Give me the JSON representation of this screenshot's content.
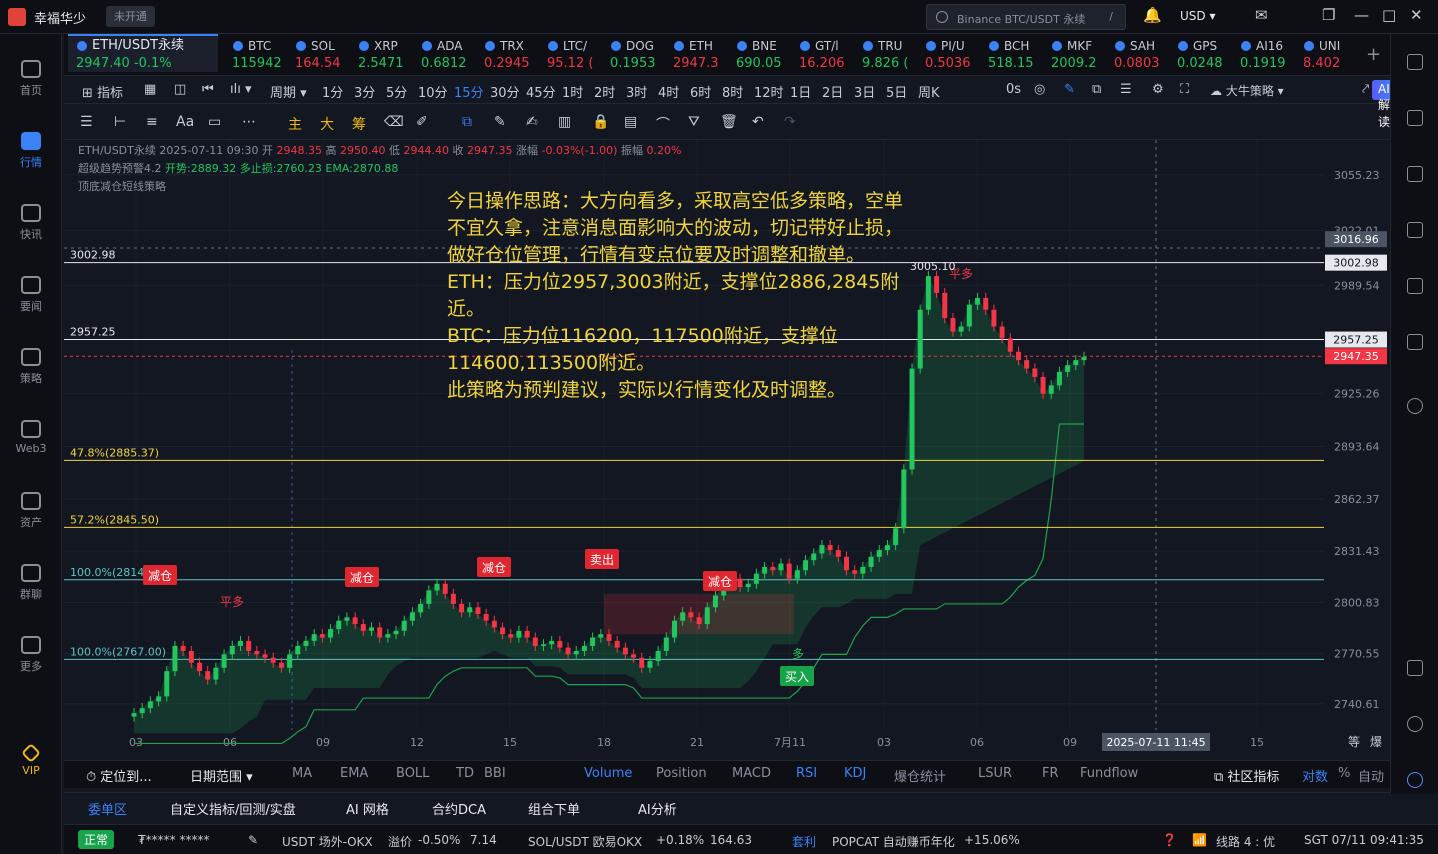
{
  "app": {
    "title": "幸福华少",
    "badge": "未开通",
    "search_placeholder": "Binance BTC/USDT 永续",
    "search_shortcut": "/",
    "currency": "USD"
  },
  "sidebar": [
    {
      "label": "首页",
      "icon": "home-icon"
    },
    {
      "label": "行情",
      "icon": "chart-bars-icon",
      "active": true
    },
    {
      "label": "快讯",
      "icon": "news-icon"
    },
    {
      "label": "要闻",
      "icon": "article-icon"
    },
    {
      "label": "策略",
      "icon": "robot-icon"
    },
    {
      "label": "Web3",
      "icon": "web3-icon"
    },
    {
      "label": "资产",
      "icon": "wallet-icon"
    },
    {
      "label": "群聊",
      "icon": "chat-icon"
    },
    {
      "label": "更多",
      "icon": "grid-icon"
    },
    {
      "label": "VIP",
      "icon": "vip-diamond-icon"
    }
  ],
  "tickers": {
    "main": {
      "name": "ETH/USDT永续",
      "price": "2947.40",
      "change": "-0.1%"
    },
    "list": [
      {
        "name": "BTC",
        "price": "115942",
        "dir": "up"
      },
      {
        "name": "SOL",
        "price": "164.54",
        "dir": "dn"
      },
      {
        "name": "XRP",
        "price": "2.5471",
        "dir": "up"
      },
      {
        "name": "ADA",
        "price": "0.6812",
        "dir": "up"
      },
      {
        "name": "TRX",
        "price": "0.2945",
        "dir": "dn"
      },
      {
        "name": "LTC/",
        "price": "95.12 (",
        "dir": "dn"
      },
      {
        "name": "DOG",
        "price": "0.1953",
        "dir": "up"
      },
      {
        "name": "ETH",
        "price": "2947.3",
        "dir": "dn"
      },
      {
        "name": "BNE",
        "price": "690.05",
        "dir": "up"
      },
      {
        "name": "GT/l",
        "price": "16.206",
        "dir": "dn"
      },
      {
        "name": "TRU",
        "price": "9.826 (",
        "dir": "up"
      },
      {
        "name": "PI/U",
        "price": "0.5036",
        "dir": "dn"
      },
      {
        "name": "BCH",
        "price": "518.15",
        "dir": "up"
      },
      {
        "name": "MKF",
        "price": "2009.2",
        "dir": "up"
      },
      {
        "name": "SAH",
        "price": "0.0803",
        "dir": "dn"
      },
      {
        "name": "GPS",
        "price": "0.0248",
        "dir": "up"
      },
      {
        "name": "AI16",
        "price": "0.1919",
        "dir": "up"
      },
      {
        "name": "UNI",
        "price": "8.402",
        "dir": "dn"
      }
    ]
  },
  "toolbar1": {
    "indicator": "指标",
    "cycle": "周期",
    "intervals": [
      "1分",
      "3分",
      "5分",
      "10分",
      "15分",
      "30分",
      "45分",
      "1时",
      "2时",
      "3时",
      "4时",
      "6时",
      "8时",
      "12时",
      "1日",
      "2日",
      "3日",
      "5日",
      "周K"
    ],
    "selected_interval": "15分",
    "timer": "0s",
    "bull_strategy": "大牛策略",
    "ai_label": "AI解读"
  },
  "toolbar2": {
    "zhu": "主",
    "da": "大",
    "chou": "筹",
    "font": "Aa"
  },
  "legend": {
    "symbol": "ETH/USDT永续",
    "datetime": "2025-07-11 09:30",
    "open_label": "开",
    "open": "2948.35",
    "high_label": "高",
    "high": "2950.40",
    "low_label": "低",
    "low": "2944.40",
    "close_label": "收",
    "close": "2947.35",
    "amp_label": "涨幅",
    "amp": "-0.03%(-1.00)",
    "swing_label": "振幅",
    "swing": "0.20%",
    "ind1": "超级趋势预警4.2",
    "ind1_a": "开势:2889.32",
    "ind1_b": "多止损:2760.23",
    "ind1_c": "EMA:2870.88",
    "ind2": "顶底减仓短线策略"
  },
  "note": [
    "今日操作思路：大方向看多，采取高空低多策略，空单不宜久拿，注意消息面影响大的波动，切记带好止损，做好仓位管理，行情有变点位要及时调整和撤单。",
    "ETH：压力位2957,3003附近，支撑位2886,2845附近。",
    "BTC：压力位116200，117500附近，支撑位114600,113500附近。",
    "此策略为预判建议，实际以行情变化及时调整。"
  ],
  "chart_data": {
    "type": "candlestick",
    "y_ticks": [
      "3055.23",
      "3022.01",
      "2989.54",
      "2957.25",
      "2925.26",
      "2893.64",
      "2862.37",
      "2831.43",
      "2800.83",
      "2770.55",
      "2740.61"
    ],
    "x_ticks": [
      "03",
      "06",
      "09",
      "12",
      "15",
      "18",
      "21",
      "7月11",
      "03",
      "06",
      "09",
      "15"
    ],
    "crosshair_time": "2025-07-11 11:45",
    "price_labels": {
      "crosshair": "3016.96",
      "hl_3002": "3002.98",
      "hl_2957": "2957.25",
      "last": "2947.35"
    },
    "horizontal_lines": [
      {
        "label": "3002.98",
        "value": 3002.98
      },
      {
        "label": "2957.25",
        "value": 2957.25
      },
      {
        "label": "47.8%(2885.37)",
        "value": 2885.37
      },
      {
        "label": "57.2%(2845.50)",
        "value": 2845.5
      },
      {
        "label": "100.0%(2814.35)",
        "value": 2814.35
      },
      {
        "label": "100.0%(2767.00)",
        "value": 2767.0
      }
    ],
    "peak_label": "3005.10",
    "markers": [
      {
        "text": "减仓",
        "type": "reduce"
      },
      {
        "text": "平多",
        "type": "close"
      },
      {
        "text": "减仓",
        "type": "reduce"
      },
      {
        "text": "减仓",
        "type": "reduce"
      },
      {
        "text": "卖出",
        "type": "sell"
      },
      {
        "text": "减仓",
        "type": "reduce"
      },
      {
        "text": "买入",
        "type": "buy"
      },
      {
        "text": "多",
        "type": "long"
      },
      {
        "text": "平多",
        "type": "close"
      }
    ],
    "ohlc_path": [
      2735,
      2738,
      2742,
      2745,
      2760,
      2775,
      2772,
      2765,
      2760,
      2755,
      2762,
      2770,
      2775,
      2778,
      2772,
      2770,
      2768,
      2765,
      2762,
      2770,
      2775,
      2778,
      2782,
      2780,
      2785,
      2790,
      2792,
      2788,
      2784,
      2786,
      2780,
      2782,
      2784,
      2790,
      2795,
      2800,
      2808,
      2812,
      2806,
      2800,
      2795,
      2798,
      2794,
      2790,
      2786,
      2782,
      2780,
      2784,
      2780,
      2775,
      2776,
      2778,
      2774,
      2770,
      2772,
      2775,
      2780,
      2782,
      2778,
      2774,
      2770,
      2768,
      2762,
      2766,
      2772,
      2780,
      2790,
      2795,
      2792,
      2788,
      2798,
      2805,
      2812,
      2815,
      2810,
      2812,
      2818,
      2822,
      2820,
      2824,
      2815,
      2820,
      2826,
      2830,
      2835,
      2832,
      2828,
      2820,
      2818,
      2822,
      2828,
      2832,
      2835,
      2845,
      2880,
      2940,
      2975,
      2995,
      2985,
      2970,
      2962,
      2965,
      2978,
      2982,
      2975,
      2965,
      2958,
      2950,
      2945,
      2940,
      2935,
      2925,
      2930,
      2938,
      2942,
      2945,
      2947
    ]
  },
  "axis_controls": {
    "zoom_a": "等",
    "zoom_b": "爆"
  },
  "indicator_tabs": {
    "locate": "定位到...",
    "date_range": "日期范围",
    "items": [
      "MA",
      "EMA",
      "BOLL",
      "TD",
      "BBI",
      "Volume",
      "Position",
      "MACD",
      "RSI",
      "KDJ",
      "爆仓统计",
      "LSUR",
      "FR",
      "Fundflow"
    ],
    "community": "社区指标",
    "pair": "对数",
    "percent": "%",
    "auto": "自动"
  },
  "panel_tabs": [
    "委单区",
    "自定义指标/回测/实盘",
    "AI 网格",
    "合约DCA",
    "组合下单",
    "AI分析"
  ],
  "status": {
    "state": "正常",
    "masked": "₮***** *****",
    "usdt_otc": "USDT 场外-OKX",
    "premium_label": "溢价",
    "premium": "-0.50%",
    "premium_value": "7.14",
    "sol_pair": "SOL/USDT 欧易OKX",
    "sol_change": "+0.18%",
    "sol_price": "164.63",
    "arb": "套利",
    "popcat": "POPCAT 自动赚币年化",
    "popcat_rate": "+15.06%",
    "line": "线路 4 : 优",
    "time": "SGT 07/11 09:41:35"
  }
}
